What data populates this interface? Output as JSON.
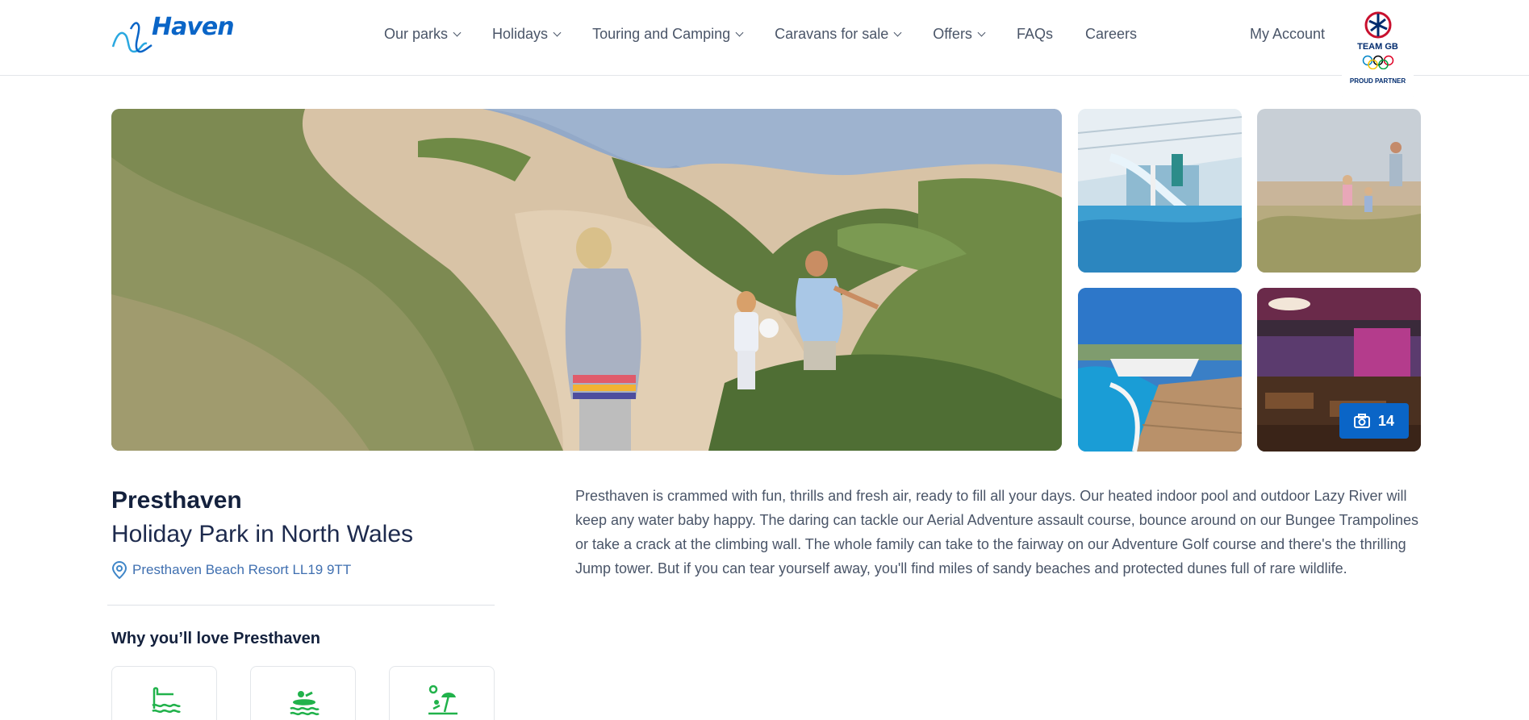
{
  "brand": {
    "name": "Haven",
    "accent": "#0a65c7",
    "icon": "haven-wave-logo"
  },
  "nav": {
    "items": [
      {
        "label": "Our parks",
        "dropdown": true
      },
      {
        "label": "Holidays",
        "dropdown": true
      },
      {
        "label": "Touring and Camping",
        "dropdown": true
      },
      {
        "label": "Caravans for sale",
        "dropdown": true
      },
      {
        "label": "Offers",
        "dropdown": true
      },
      {
        "label": "FAQs",
        "dropdown": false
      },
      {
        "label": "Careers",
        "dropdown": false
      }
    ],
    "account": "My Account"
  },
  "partner": {
    "line1": "TEAM GB",
    "line2": "PROUD PARTNER",
    "icon": "team-gb-lion-icon"
  },
  "gallery": {
    "photo_count": "14",
    "camera_icon": "camera-icon"
  },
  "park": {
    "name": "Presthaven",
    "subtitle": "Holiday Park in North Wales",
    "address": "Presthaven Beach Resort LL19 9TT",
    "description": "Presthaven is crammed with fun, thrills and fresh air, ready to fill all your days. Our heated indoor pool and outdoor Lazy River will keep any water baby happy. The daring can tackle our Aerial Adventure assault course, bounce around on our Bungee Trampolines or take a crack at the climbing wall. The whole family can take to the fairway on our Adventure Golf course and there's the thrilling Jump tower. But if you can tear yourself away, you'll find miles of sandy beaches and protected dunes full of rare wildlife."
  },
  "why": {
    "heading": "Why you’ll love Presthaven",
    "features": [
      {
        "icon": "swimming-pool-icon"
      },
      {
        "icon": "lazy-river-icon"
      },
      {
        "icon": "beach-icon"
      }
    ]
  }
}
